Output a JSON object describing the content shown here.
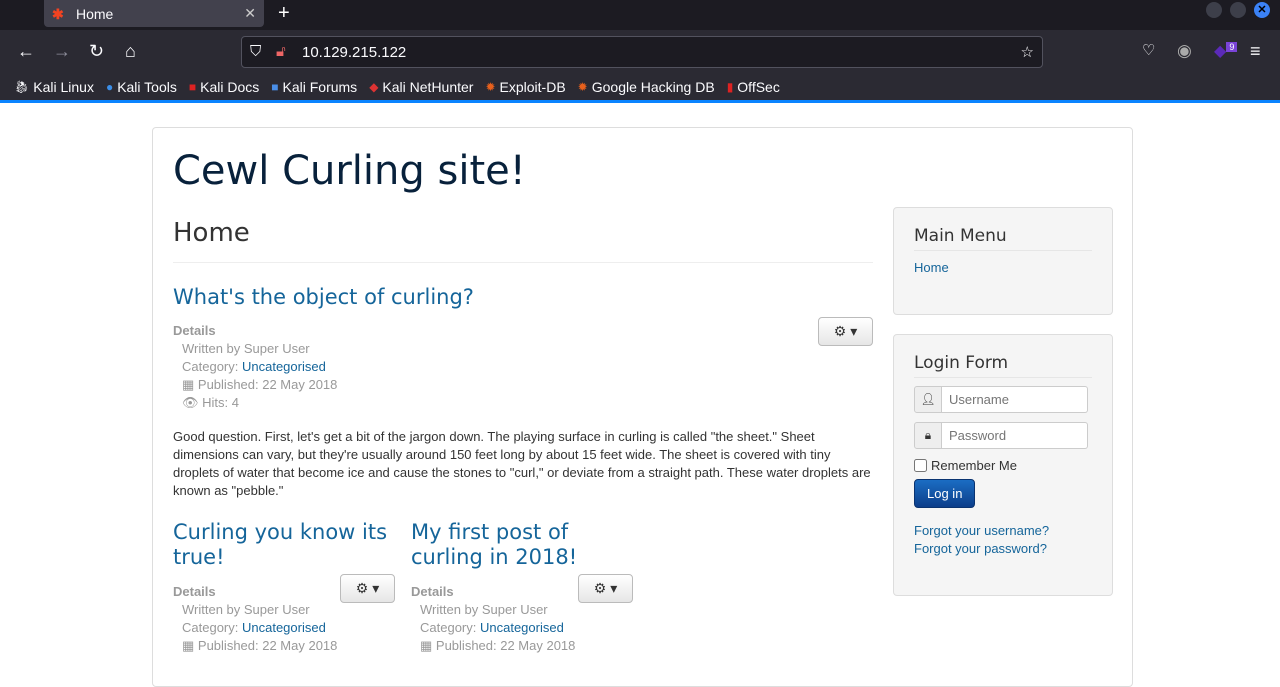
{
  "browser": {
    "tab_title": "Home",
    "url": "10.129.215.122",
    "badge": "9",
    "bookmarks": [
      "Kali Linux",
      "Kali Tools",
      "Kali Docs",
      "Kali Forums",
      "Kali NetHunter",
      "Exploit-DB",
      "Google Hacking DB",
      "OffSec"
    ]
  },
  "site": {
    "title": "Cewl Curling site!",
    "page_heading": "Home"
  },
  "articles": [
    {
      "title": "What's the object of curling?",
      "details": "Details",
      "author": "Written by Super User",
      "category_label": "Category: ",
      "category": "Uncategorised",
      "published": "Published: 22 May 2018",
      "hits": "Hits: 4",
      "body": "Good question. First, let's get a bit of the jargon down. The playing surface in curling is called \"the sheet.\" Sheet dimensions can vary, but they're usually around 150 feet long by about 15 feet wide. The sheet is covered with tiny droplets of water that become ice and cause the stones to \"curl,\" or deviate from a straight path. These water droplets are known as \"pebble.\""
    },
    {
      "title": "Curling you know its true!",
      "details": "Details",
      "author": "Written by Super User",
      "category_label": "Category: ",
      "category": "Uncategorised",
      "published": "Published: 22 May 2018"
    },
    {
      "title": "My first post of curling in 2018!",
      "details": "Details",
      "author": "Written by Super User",
      "category_label": "Category: ",
      "category": "Uncategorised",
      "published": "Published: 22 May 2018"
    }
  ],
  "sidebar": {
    "main_menu": {
      "title": "Main Menu",
      "items": [
        "Home"
      ]
    },
    "login": {
      "title": "Login Form",
      "username_placeholder": "Username",
      "password_placeholder": "Password",
      "remember": "Remember Me",
      "submit": "Log in",
      "forgot_username": "Forgot your username?",
      "forgot_password": "Forgot your password?"
    }
  }
}
